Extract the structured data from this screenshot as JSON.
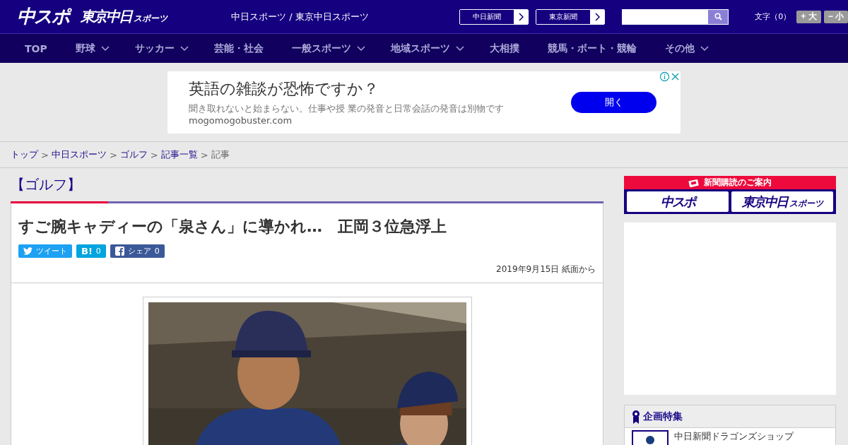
{
  "header": {
    "logo_main": "中スポ",
    "logo_sub": "東京中日",
    "logo_sub_small": "スポーツ",
    "site_names": "中日スポーツ / 東京中日スポーツ",
    "paper_links": [
      "中日新聞",
      "東京新聞"
    ],
    "font_size": {
      "label": "文字（0）",
      "larger": "+ 大",
      "smaller": "− 小"
    }
  },
  "nav": [
    {
      "label": "TOP",
      "has_menu": false
    },
    {
      "label": "野球",
      "has_menu": true
    },
    {
      "label": "サッカー",
      "has_menu": true
    },
    {
      "label": "芸能・社会",
      "has_menu": false
    },
    {
      "label": "一般スポーツ",
      "has_menu": true
    },
    {
      "label": "地域スポーツ",
      "has_menu": true
    },
    {
      "label": "大相撲",
      "has_menu": false
    },
    {
      "label": "競馬・ボート・競輪",
      "has_menu": false
    },
    {
      "label": "その他",
      "has_menu": true
    }
  ],
  "ad": {
    "headline": "英語の雑談が恐怖ですか？",
    "body": "聞き取れないと始まらない。仕事や授 業の発音と日常会話の発音は別物です",
    "domain": "mogomogobuster.com",
    "button": "開く"
  },
  "breadcrumb": [
    {
      "kind": "link",
      "label": "トップ"
    },
    {
      "kind": "separator",
      "label": ">"
    },
    {
      "kind": "link",
      "label": "中日スポーツ"
    },
    {
      "kind": "separator",
      "label": ">"
    },
    {
      "kind": "link",
      "label": "ゴルフ"
    },
    {
      "kind": "separator",
      "label": ">"
    },
    {
      "kind": "link",
      "label": "記事一覧"
    },
    {
      "kind": "separator",
      "label": ">"
    },
    {
      "kind": "current",
      "label": "記事"
    }
  ],
  "category": "【ゴルフ】",
  "article": {
    "title": "すご腕キャディーの「泉さん」に導かれ…　正岡３位急浮上",
    "share": [
      {
        "kind": "twitter",
        "label": "ツイート"
      },
      {
        "kind": "hatena",
        "label": "B!",
        "count": "0"
      },
      {
        "kind": "facebook",
        "label": "シェア",
        "count": "0"
      }
    ],
    "date": "2019年9月15日 紙面から"
  },
  "sidebar": {
    "subscribe": {
      "title": "新聞購読のご案内",
      "logos": [
        {
          "main": "中スポ"
        },
        {
          "main": "東京中日",
          "small": "スポーツ"
        }
      ]
    },
    "feature": {
      "title": "企画特集",
      "items": [
        "中日新聞ドラゴンズショップ"
      ]
    }
  }
}
